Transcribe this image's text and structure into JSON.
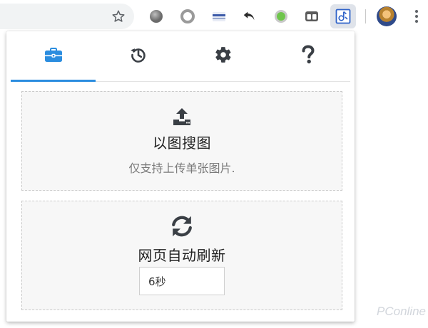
{
  "browser": {
    "extensions": [
      {
        "name": "grey-sphere-icon"
      },
      {
        "name": "ring-icon"
      },
      {
        "name": "striped-card-icon"
      },
      {
        "name": "undo-icon"
      },
      {
        "name": "green-dot-icon"
      },
      {
        "name": "tab-manager-icon"
      },
      {
        "name": "image-search-extension-icon",
        "active": true
      }
    ]
  },
  "popup": {
    "tabs": [
      {
        "id": "toolbox",
        "icon": "toolbox-icon",
        "active": true
      },
      {
        "id": "history",
        "icon": "history-icon",
        "active": false
      },
      {
        "id": "settings",
        "icon": "gear-icon",
        "active": false
      },
      {
        "id": "help",
        "icon": "question-icon",
        "active": false
      }
    ],
    "image_search": {
      "title": "以图搜图",
      "subtitle": "仅支持上传单张图片."
    },
    "auto_refresh": {
      "title": "网页自动刷新",
      "interval_value": "6秒"
    }
  },
  "watermark": "PConline",
  "colors": {
    "accent": "#2b8ddf",
    "icon_dark": "#3a3f45",
    "card_bg": "#f7f7f7"
  }
}
